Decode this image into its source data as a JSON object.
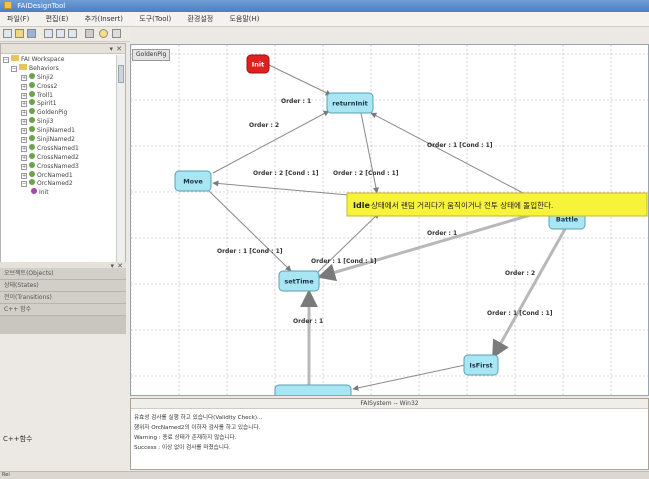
{
  "window": {
    "title": "FAIDesignTool"
  },
  "menu": [
    "파일(F)",
    "편집(E)",
    "추가(Insert)",
    "도구(Tool)",
    "환경설정",
    "도움말(H)"
  ],
  "workspace": {
    "header": "",
    "tree": [
      {
        "label": "FAI Workspace",
        "kind": "root",
        "expanded": true,
        "indent": 0
      },
      {
        "label": "Behaviors",
        "kind": "folder",
        "expanded": true,
        "indent": 1
      },
      {
        "label": "Sinji2",
        "kind": "gear",
        "indent": 2
      },
      {
        "label": "Cross2",
        "kind": "gear",
        "indent": 2
      },
      {
        "label": "Troll1",
        "kind": "gear",
        "indent": 2
      },
      {
        "label": "Spirit1",
        "kind": "gear",
        "indent": 2
      },
      {
        "label": "GoldenPig",
        "kind": "gear",
        "indent": 2
      },
      {
        "label": "Sinji3",
        "kind": "gear",
        "indent": 2
      },
      {
        "label": "SinjiNamed1",
        "kind": "gear",
        "indent": 2
      },
      {
        "label": "SinjiNamed2",
        "kind": "gear",
        "indent": 2
      },
      {
        "label": "CrossNamed1",
        "kind": "gear",
        "indent": 2
      },
      {
        "label": "CrossNamed2",
        "kind": "gear",
        "indent": 2
      },
      {
        "label": "CrossNamed3",
        "kind": "gear",
        "indent": 2
      },
      {
        "label": "OrcNamed1",
        "kind": "gear",
        "indent": 2
      },
      {
        "label": "OrcNamed2",
        "kind": "gear",
        "indent": 2
      },
      {
        "label": "Init",
        "kind": "leaf",
        "indent": 3
      }
    ]
  },
  "properties": {
    "rows": [
      "오브젝트(Objects)",
      "상태(States)",
      "전이(Transitions)",
      "C++ 함수"
    ]
  },
  "lower_panel": {
    "label": "C++함수"
  },
  "canvas": {
    "tab": "GoldenPig",
    "states": [
      {
        "id": "init",
        "label": "Init"
      },
      {
        "id": "returninit",
        "label": "returnInit"
      },
      {
        "id": "move",
        "label": "Move"
      },
      {
        "id": "idle",
        "label": "Idle"
      },
      {
        "id": "battle",
        "label": "Battle"
      },
      {
        "id": "settime",
        "label": "setTime"
      },
      {
        "id": "isfirst",
        "label": "IsFirst"
      },
      {
        "id": "bottom",
        "label": ""
      }
    ],
    "transitions": [
      {
        "label": "Order : 1"
      },
      {
        "label": "Order : 2"
      },
      {
        "label": "Order : 2 [Cond : 1]"
      },
      {
        "label": "Order : 2 [Cond : 1]"
      },
      {
        "label": "Order : 1 [Cond : 1]"
      },
      {
        "label": "Order : 1"
      },
      {
        "label": "Order : 1 [Cond : 1]"
      },
      {
        "label": "Order : 1 [Cond : 1]"
      },
      {
        "label": "Order : 1"
      },
      {
        "label": "Order : 2"
      },
      {
        "label": "Order : 1 [Cond : 1]"
      }
    ],
    "tooltip_prefix": "Idle",
    "tooltip_text": "상태에서 랜덤 거리다가 움직이거나 전투 상태에 돌입한다."
  },
  "output": {
    "title": "FAISystem -- Win32",
    "lines": [
      "유효성 검사를 실행 하고 있습니다(Validity Check)...",
      "행위자 OrcNamed2의 이하자 검사를 하고 있습니다.",
      "Warning : 종료 상태가 존재하지 않습니다.",
      "Success : 이상 없이 검사를 마쳤습니다."
    ]
  },
  "statusbar": {
    "text": "Rei"
  },
  "colors": {
    "state_fill": "#a8e6f4",
    "state_border": "#5a9fb5",
    "init_fill": "#e02020",
    "tooltip_fill": "#f7f23a",
    "grid": "#c6c6d6"
  }
}
